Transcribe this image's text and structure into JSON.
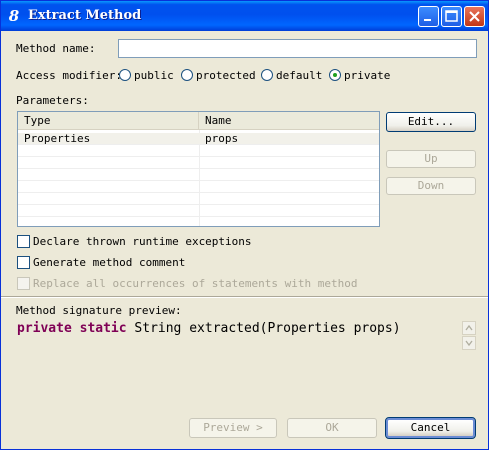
{
  "window": {
    "title": "Extract Method",
    "icon_glyph": "8"
  },
  "form": {
    "method_name_label": "Method name:",
    "method_name_value": "",
    "access_modifier_label": "Access modifier:",
    "access_modifiers": [
      {
        "label": "public",
        "selected": false
      },
      {
        "label": "protected",
        "selected": false
      },
      {
        "label": "default",
        "selected": false
      },
      {
        "label": "private",
        "selected": true
      }
    ],
    "parameters_label": "Parameters:"
  },
  "parameters_table": {
    "columns": [
      "Type",
      "Name"
    ],
    "rows": [
      {
        "type": "Properties",
        "name": "props"
      }
    ]
  },
  "side_buttons": {
    "edit": "Edit...",
    "up": "Up",
    "down": "Down"
  },
  "options": {
    "declare_exceptions": {
      "label": "Declare thrown runtime exceptions",
      "checked": false,
      "enabled": true
    },
    "generate_comment": {
      "label": "Generate method comment",
      "checked": false,
      "enabled": true
    },
    "replace_occurrences": {
      "label": "Replace all occurrences of statements with method",
      "checked": false,
      "enabled": false
    }
  },
  "preview": {
    "label": "Method signature preview:",
    "keyword1": "private",
    "keyword2": "static",
    "rest": "String extracted(Properties props)"
  },
  "footer_buttons": {
    "preview": "Preview >",
    "ok": "OK",
    "cancel": "Cancel"
  },
  "colors": {
    "titlebar": "#0053ee",
    "dialog_bg": "#ece9d8",
    "keyword": "#7f0055",
    "radio_dot": "#21a121"
  }
}
